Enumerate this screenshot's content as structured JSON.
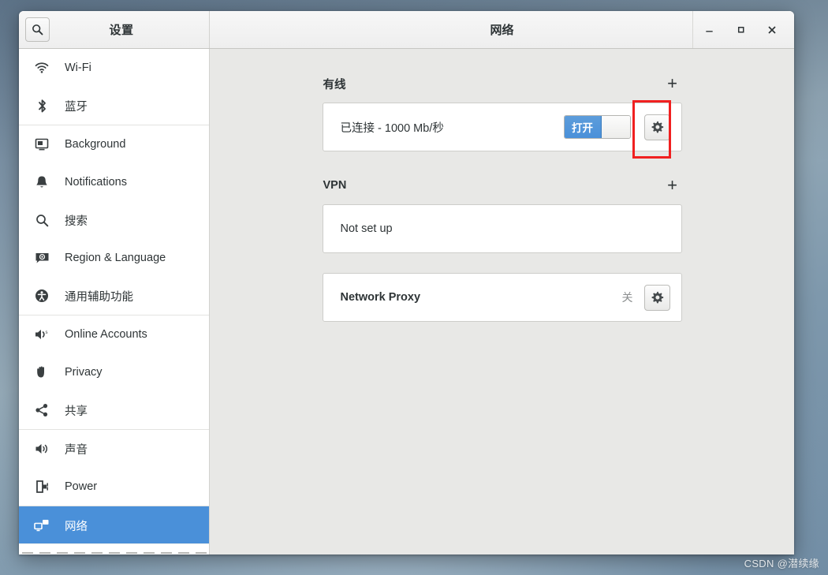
{
  "window": {
    "settings_title": "设置",
    "network_title": "网络",
    "search_icon": "search-icon",
    "controls": {
      "minimize": "—",
      "maximize": "▢",
      "close": "✕"
    }
  },
  "sidebar": {
    "groups": [
      {
        "items": [
          {
            "label": "Wi-Fi",
            "icon": "wifi-icon",
            "key": "wifi",
            "selected": false
          },
          {
            "label": "蓝牙",
            "icon": "bluetooth-icon",
            "key": "bluetooth",
            "selected": false
          }
        ]
      },
      {
        "items": [
          {
            "label": "Background",
            "icon": "background-icon",
            "key": "background",
            "selected": false
          },
          {
            "label": "Notifications",
            "icon": "bell-icon",
            "key": "notifications",
            "selected": false
          },
          {
            "label": "搜索",
            "icon": "search-icon",
            "key": "search",
            "selected": false
          },
          {
            "label": "Region & Language",
            "icon": "region-language-icon",
            "key": "region-language",
            "selected": false
          },
          {
            "label": "通用辅助功能",
            "icon": "accessibility-icon",
            "key": "accessibility",
            "selected": false
          }
        ]
      },
      {
        "items": [
          {
            "label": "Online Accounts",
            "icon": "online-accounts-icon",
            "key": "online-accounts",
            "selected": false
          },
          {
            "label": "Privacy",
            "icon": "hand-icon",
            "key": "privacy",
            "selected": false
          },
          {
            "label": "共享",
            "icon": "share-icon",
            "key": "sharing",
            "selected": false
          }
        ]
      },
      {
        "items": [
          {
            "label": "声音",
            "icon": "speaker-icon",
            "key": "sound",
            "selected": false
          },
          {
            "label": "Power",
            "icon": "power-icon",
            "key": "power",
            "selected": false
          }
        ]
      },
      {
        "items": [
          {
            "label": "网络",
            "icon": "network-icon",
            "key": "network",
            "selected": true
          }
        ]
      }
    ]
  },
  "main": {
    "wired": {
      "title": "有线",
      "add_label": "+",
      "status": "已连接 - 1000 Mb/秒",
      "toggle_label": "打开",
      "toggle_state": "on",
      "gear_icon": "gear-icon"
    },
    "vpn": {
      "title": "VPN",
      "add_label": "+",
      "status": "Not set up"
    },
    "proxy": {
      "label": "Network Proxy",
      "value": "关",
      "gear_icon": "gear-icon"
    }
  },
  "annotation": {
    "color": "#f02020",
    "target": "wired-gear-button"
  },
  "watermark": {
    "text": "CSDN @潜续缘"
  },
  "colors": {
    "accent": "#4a90d9",
    "content_bg": "#e8e8e6",
    "panel_bg": "#ffffff",
    "text": "#2e3436"
  }
}
